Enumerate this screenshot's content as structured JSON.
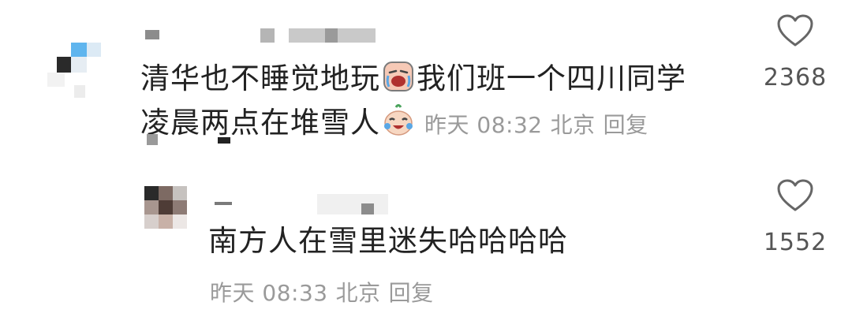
{
  "comments": [
    {
      "text_part1": "清华也不睡觉地玩",
      "text_part2": "我们班一个四川同学",
      "text_part3": "凌晨两点在堆雪人",
      "emoji1": "crying-face-emoji",
      "emoji2": "laughing-tears-emoji",
      "time": "昨天 08:32",
      "location": "北京",
      "reply_label": "回复",
      "like_count": "2368",
      "like_icon": "heart-outline-icon"
    },
    {
      "text": "南方人在雪里迷失哈哈哈哈",
      "time": "昨天 08:33",
      "location": "北京",
      "reply_label": "回复",
      "like_count": "1552",
      "like_icon": "heart-outline-icon"
    }
  ]
}
